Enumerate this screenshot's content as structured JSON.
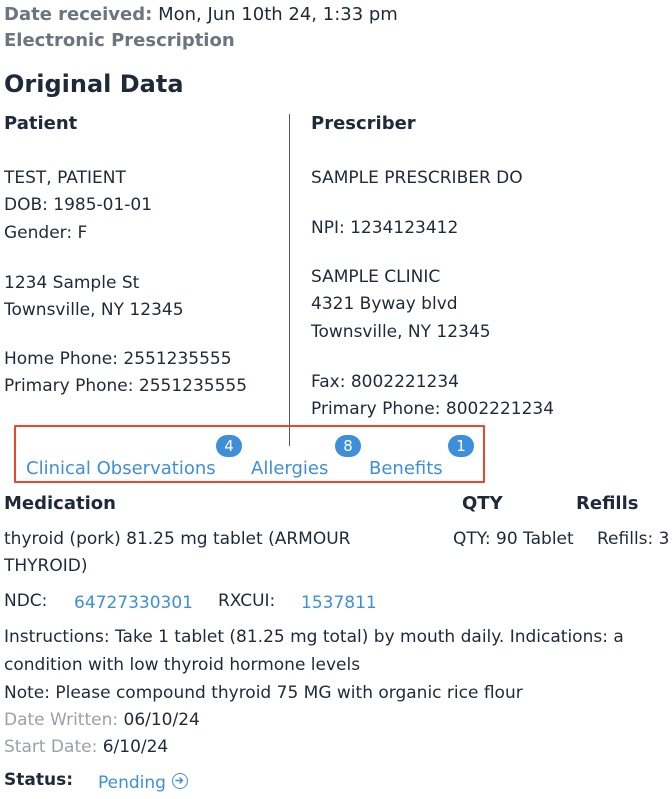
{
  "header": {
    "date_received_label": "Date received:",
    "date_received_value": "Mon, Jun 10th 24, 1:33 pm",
    "type": "Electronic Prescription"
  },
  "original": {
    "title": "Original Data",
    "patient": {
      "heading": "Patient",
      "name": "TEST, PATIENT",
      "dob": "DOB: 1985-01-01",
      "gender": "Gender: F",
      "address1": "1234 Sample St",
      "address2": "Townsville, NY 12345",
      "home_phone": "Home Phone: 2551235555",
      "primary_phone": "Primary Phone: 2551235555"
    },
    "prescriber": {
      "heading": "Prescriber",
      "name": "SAMPLE PRESCRIBER DO",
      "npi": "NPI: 1234123412",
      "clinic": "SAMPLE CLINIC",
      "address1": "4321 Byway blvd",
      "address2": "Townsville, NY 12345",
      "fax": "Fax: 8002221234",
      "primary_phone": "Primary Phone: 8002221234"
    }
  },
  "tabs": [
    {
      "label": "Clinical Observations",
      "count": "4"
    },
    {
      "label": "Allergies",
      "count": "8"
    },
    {
      "label": "Benefits",
      "count": "1"
    }
  ],
  "medication": {
    "col_medication": "Medication",
    "col_qty": "QTY",
    "col_refills": "Refills",
    "name_line1": "thyroid (pork) 81.25 mg tablet (ARMOUR",
    "name_line2": "THYROID)",
    "qty": "QTY: 90 Tablet",
    "refills": "Refills: 3",
    "ndc_label": "NDC:",
    "ndc_value": "64727330301",
    "rxcui_label": "RXCUI:",
    "rxcui_value": "1537811",
    "instructions_line1": "Instructions: Take 1 tablet (81.25 mg total) by mouth daily. Indications: a",
    "instructions_line2": "condition with low thyroid hormone levels",
    "note": "Note: Please compound thyroid 75 MG with organic rice flour",
    "date_written_label": "Date Written:",
    "date_written_value": "06/10/24",
    "start_date_label": "Start Date:",
    "start_date_value": "6/10/24",
    "status_label": "Status:",
    "status_value": "Pending",
    "status_icon": "arrow-circle-right-icon"
  },
  "colors": {
    "accent": "#3d8fd9",
    "highlight_border": "#e8492e",
    "text": "#1e2a3a",
    "muted": "#6c7480"
  }
}
